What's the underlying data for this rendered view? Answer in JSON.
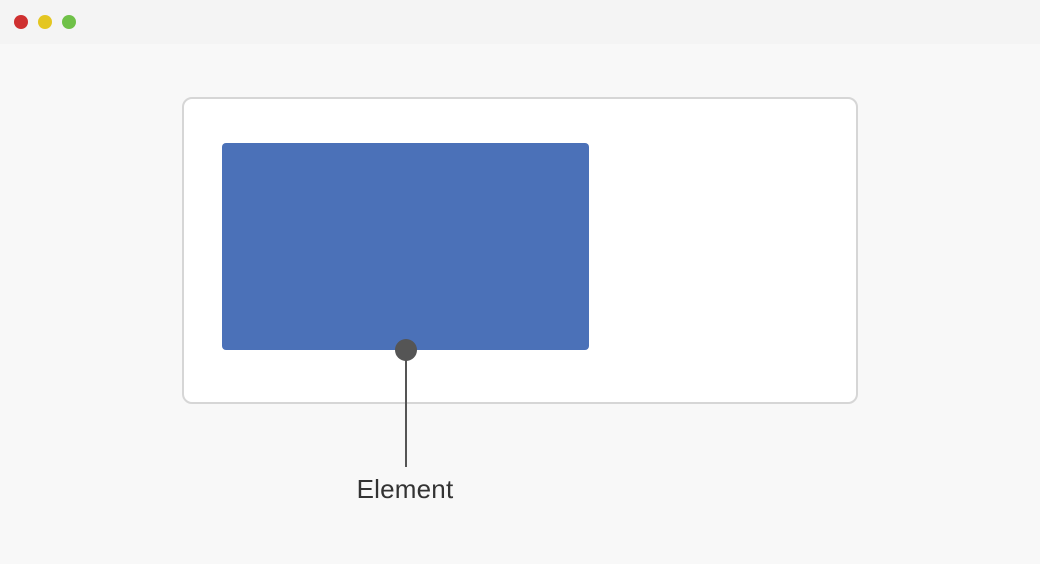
{
  "window": {
    "traffic_lights": {
      "close": "close",
      "minimize": "minimize",
      "zoom": "zoom"
    }
  },
  "diagram": {
    "callout_label": "Element",
    "colors": {
      "element_fill": "#4b71b8",
      "panel_border": "#d6d6d6",
      "callout": "#555555"
    }
  }
}
